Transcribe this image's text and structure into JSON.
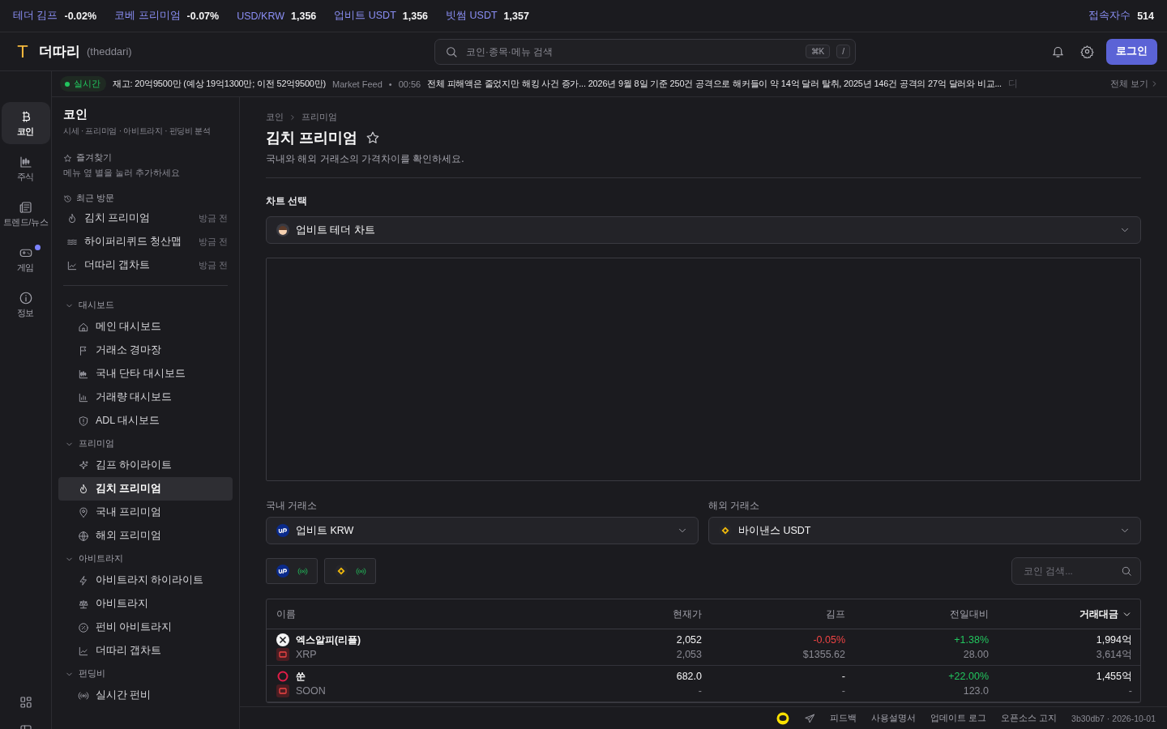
{
  "ticker": [
    {
      "label": "테더 김프",
      "value": "-0.02%"
    },
    {
      "label": "코베 프리미엄",
      "value": "-0.07%"
    },
    {
      "label": "USD/KRW",
      "value": "1,356"
    },
    {
      "label": "업비트 USDT",
      "value": "1,356"
    },
    {
      "label": "빗썸 USDT",
      "value": "1,357"
    }
  ],
  "visitors": {
    "label": "접속자수",
    "value": "514"
  },
  "brand": {
    "logo": "T",
    "name": "더따리",
    "handle": "(theddari)"
  },
  "search": {
    "placeholder": "코인·종목·메뉴 검색",
    "keys": [
      "⌘K",
      "/"
    ]
  },
  "login": "로그인",
  "news": {
    "live": "실시간",
    "items": [
      {
        "text": "재고: 20억9500만 (예상 19억1300만; 이전 52억9500만)",
        "source": "Market Feed"
      },
      {
        "separator": "•",
        "time": "00:56",
        "text": "전체 피해액은 줄었지만 해킹 사건 증가... 2026년 9월 8일 기준 250건 공격으로 해커들이 약 14억 달러 탈취, 2025년 146건 공격의 27억 달러와 비교..."
      }
    ],
    "cut": "디",
    "more": "전체 보기"
  },
  "rail": [
    {
      "label": "코인",
      "selected": true,
      "badge": false
    },
    {
      "label": "주식",
      "selected": false,
      "badge": false
    },
    {
      "label": "트렌드/뉴스",
      "selected": false,
      "badge": false
    },
    {
      "label": "게임",
      "selected": false,
      "badge": true
    },
    {
      "label": "정보",
      "selected": false,
      "badge": false
    }
  ],
  "sidebar": {
    "title": "코인",
    "subtitle": "시세 · 프리미엄 · 아비트라지 · 펀딩비 분석",
    "favorites": {
      "label": "즐겨찾기",
      "hint": "메뉴 옆 별을 눌러 추가하세요"
    },
    "recent": {
      "label": "최근 방문",
      "items": [
        {
          "label": "김치 프리미엄",
          "time": "방금 전"
        },
        {
          "label": "하이퍼리퀴드 청산맵",
          "time": "방금 전"
        },
        {
          "label": "더따리 갭차트",
          "time": "방금 전"
        }
      ]
    },
    "groups": [
      {
        "label": "대시보드",
        "expanded": true,
        "items": [
          {
            "label": "메인 대시보드",
            "selected": false
          },
          {
            "label": "거래소 경마장",
            "selected": false
          },
          {
            "label": "국내 단타 대시보드",
            "selected": false
          },
          {
            "label": "거래량 대시보드",
            "selected": false
          },
          {
            "label": "ADL 대시보드",
            "selected": false
          }
        ]
      },
      {
        "label": "프리미엄",
        "expanded": true,
        "items": [
          {
            "label": "김프 하이라이트",
            "selected": false
          },
          {
            "label": "김치 프리미엄",
            "selected": true
          },
          {
            "label": "국내 프리미엄",
            "selected": false
          },
          {
            "label": "해외 프리미엄",
            "selected": false
          }
        ]
      },
      {
        "label": "아비트라지",
        "expanded": true,
        "items": [
          {
            "label": "아비트라지 하이라이트",
            "selected": false
          },
          {
            "label": "아비트라지",
            "selected": false
          },
          {
            "label": "펀비 아비트라지",
            "selected": false
          },
          {
            "label": "더따리 갭차트",
            "selected": false
          }
        ]
      },
      {
        "label": "펀딩비",
        "expanded": true,
        "items": [
          {
            "label": "실시간 펀비",
            "selected": false
          }
        ]
      }
    ]
  },
  "page": {
    "breadcrumb": [
      "코인",
      "프리미엄"
    ],
    "title": "김치 프리미엄",
    "description": "국내와 해외 거래소의 가격차이를 확인하세요.",
    "chart_select": {
      "label": "차트 선택",
      "value": "업비트 테더 차트"
    },
    "domestic": {
      "label": "국내 거래소",
      "value": "업비트 KRW",
      "kind": "upbit"
    },
    "foreign": {
      "label": "해외 거래소",
      "value": "바이낸스 USDT",
      "kind": "binance"
    },
    "connections": [
      {
        "kind": "upbit",
        "connected": true
      },
      {
        "kind": "binance",
        "connected": true
      }
    ],
    "coin_search": {
      "placeholder": "코인 검색..."
    },
    "table": {
      "columns": [
        {
          "label": "이름",
          "sorted": false
        },
        {
          "label": "현재가",
          "sorted": false
        },
        {
          "label": "김프",
          "sorted": false
        },
        {
          "label": "전일대비",
          "sorted": false
        },
        {
          "label": "거래대금",
          "sorted": true
        }
      ],
      "rows": [
        {
          "kind": "cross",
          "name": "엑스알피(리플)",
          "symbol": "XRP",
          "price": "2,052",
          "price_foreign": "2,053",
          "kimp": {
            "text": "-0.05%",
            "color": "#ef4444"
          },
          "kimp_usd": "$1355.62",
          "change": {
            "text": "+1.38%",
            "color": "#22c55e"
          },
          "change_abs": "28.00",
          "volume": "1,994억",
          "volume_foreign": "3,614억"
        },
        {
          "kind": "ring",
          "name": "쑨",
          "symbol": "SOON",
          "price": "682.0",
          "price_foreign": "-",
          "kimp": {
            "text": "-"
          },
          "kimp_usd": "-",
          "change": {
            "text": "+22.00%",
            "color": "#22c55e"
          },
          "change_abs": "123.0",
          "volume": "1,455억",
          "volume_foreign": "-"
        }
      ]
    }
  },
  "footer": {
    "links": [
      "피드백",
      "사용설명서",
      "업데이트 로그",
      "오픈소스 고지"
    ],
    "version": "3b30db7 · 2026-10-01"
  }
}
